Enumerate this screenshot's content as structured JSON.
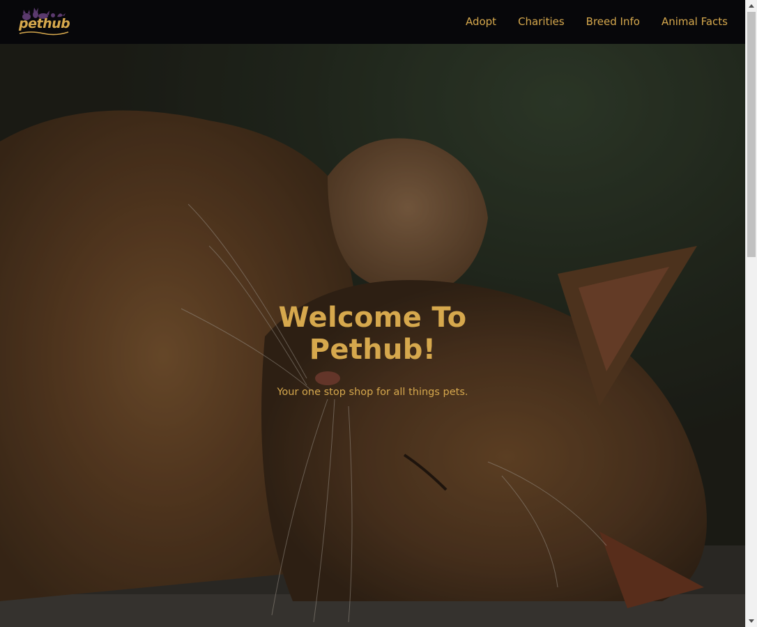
{
  "brand": {
    "logo_text": "pethub",
    "color": "#d6a84d"
  },
  "nav": {
    "items": [
      {
        "label": "Adopt"
      },
      {
        "label": "Charities"
      },
      {
        "label": "Breed Info"
      },
      {
        "label": "Animal Facts"
      }
    ]
  },
  "hero": {
    "title": "Welcome To Pethub!",
    "subtitle": "Your one stop shop for all things pets.",
    "image": "sleeping orange cat photo"
  },
  "colors": {
    "navbar_bg": "#07070a",
    "accent": "#d6a84d"
  }
}
